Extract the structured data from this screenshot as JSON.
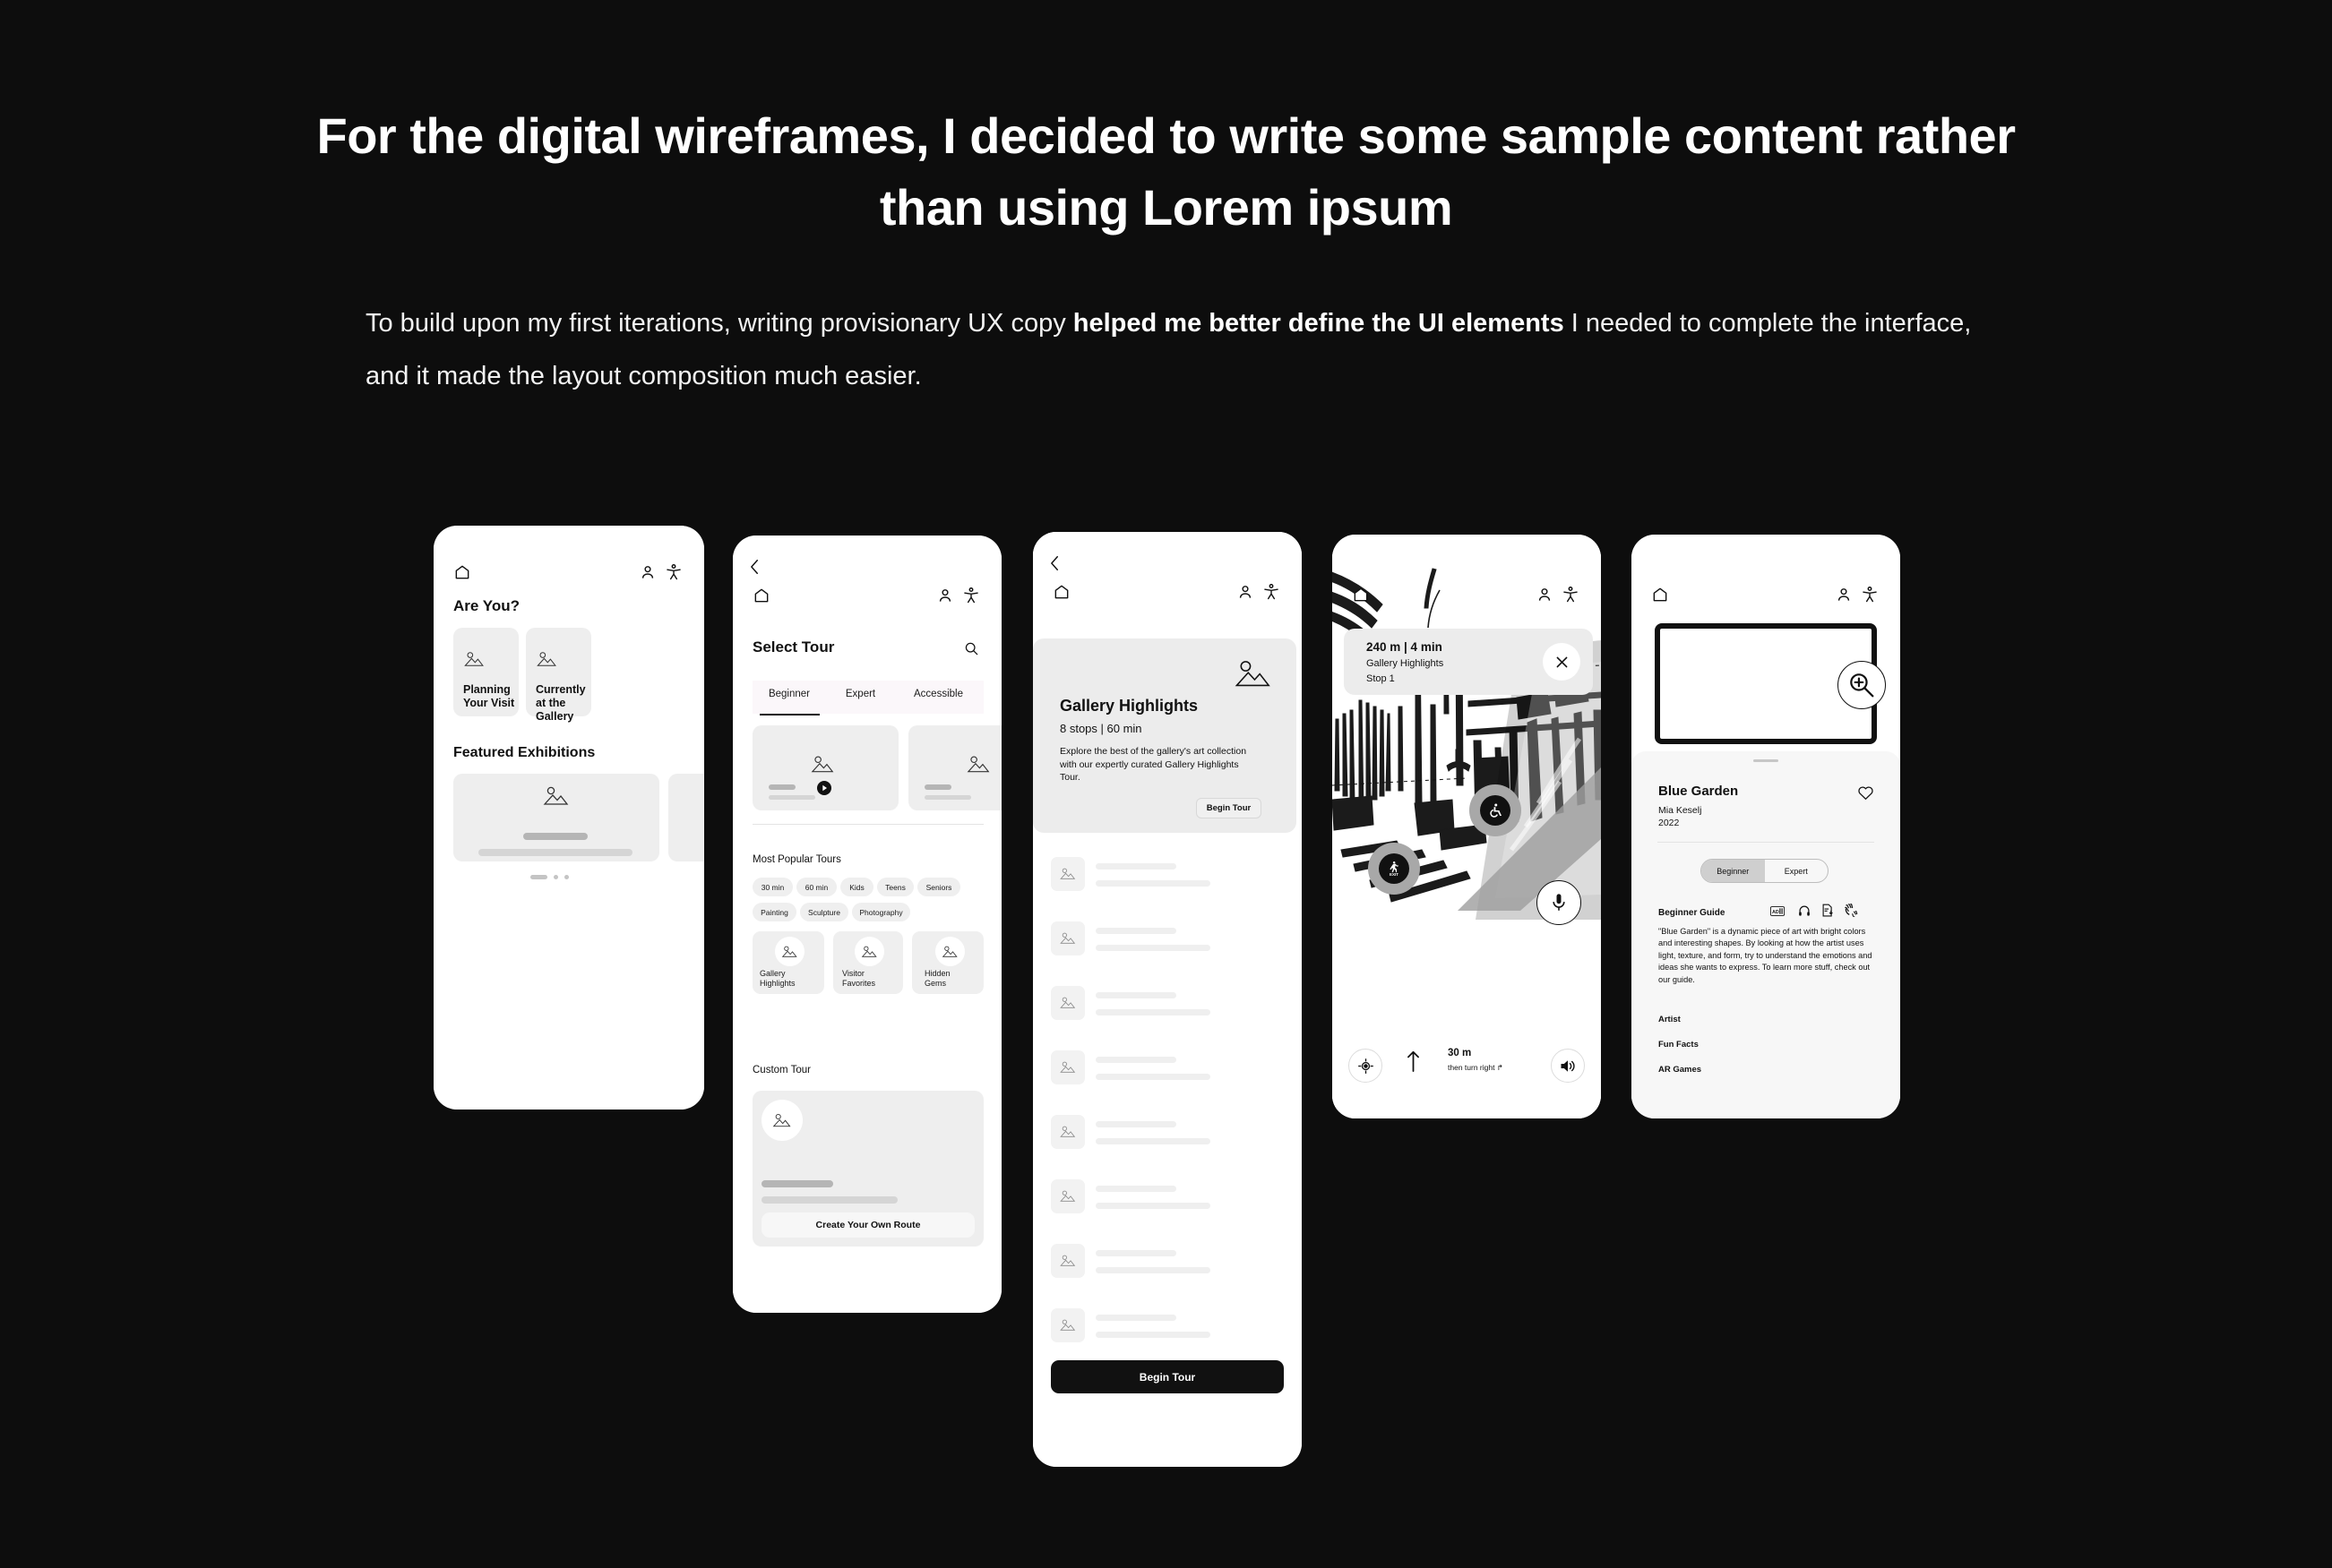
{
  "header": {
    "headline": "For the digital wireframes, I decided to write some  sample content rather than using Lorem ipsum",
    "body_pre": "To build upon my first iterations, writing provisionary UX copy ",
    "body_bold": "helped me better define the UI elements",
    "body_post": " I needed to complete the interface, and it made the layout composition much easier."
  },
  "colors": {
    "background": "#0d0d0d",
    "text": "#ffffff",
    "phone": "#ffffff",
    "placeholder_grey": "#eeeeee",
    "accent_dark": "#111111",
    "tab_strip": "#fbf7fa"
  },
  "screens": [
    {
      "id": "home",
      "icons": {
        "home": "home-icon",
        "profile": "person-icon",
        "accessibility": "accessibility-icon"
      },
      "title": "Are You?",
      "cards": [
        {
          "label": "Planning\nYour Visit",
          "line1": "Planning",
          "line2": "Your Visit",
          "icon": "image-placeholder-icon"
        },
        {
          "label": "Currently\nat the Gallery",
          "line1": "Currently",
          "line2": "at the Gallery",
          "icon": "image-placeholder-icon"
        }
      ],
      "featured_title": "Featured Exhibitions",
      "carousel_dots": 3,
      "carousel_active": 0
    },
    {
      "id": "select-tour",
      "back": "back-chevron-icon",
      "title": "Select Tour",
      "search": "search-icon",
      "tabs": [
        {
          "label": "Beginner",
          "active": true
        },
        {
          "label": "Expert",
          "active": false
        },
        {
          "label": "Accessible",
          "active": false
        }
      ],
      "popular_title": "Most Popular Tours",
      "chips": [
        "30 min",
        "60 min",
        "Kids",
        "Teens",
        "Seniors",
        "Painting",
        "Sculpture",
        "Photography"
      ],
      "tiles": [
        {
          "line1": "Gallery",
          "line2": "Highlights"
        },
        {
          "line1": "Visitor",
          "line2": "Favorites"
        },
        {
          "line1": "Hidden",
          "line2": "Gems"
        }
      ],
      "custom_title": "Custom Tour",
      "custom_button": "Create Your Own Route"
    },
    {
      "id": "tour-detail",
      "back": "back-chevron-icon",
      "title": "Gallery Highlights",
      "subtitle": "8 stops | 60 min",
      "description": "Explore the best of the gallery's art collection with our expertly curated Gallery Highlights Tour.",
      "begin_small": "Begin Tour",
      "begin_primary": "Begin Tour",
      "stop_rows": 8
    },
    {
      "id": "ar-navigation",
      "distance": "240 m | 4 min",
      "tour_name": "Gallery Highlights",
      "stop": "Stop 1",
      "close": "close-icon",
      "pois": [
        {
          "icon": "wheelchair-icon",
          "name": "accessible-route-poi"
        },
        {
          "icon": "exit-icon",
          "label": "EXIT",
          "name": "exit-poi"
        }
      ],
      "mic": "microphone-icon",
      "recenter": "recenter-icon",
      "nav_distance": "30 m",
      "nav_instruction": "then turn right ↱",
      "nav_arrow": "up-arrow-icon",
      "sound": "volume-icon"
    },
    {
      "id": "artwork-detail",
      "zoom": "zoom-in-icon",
      "favorite": "heart-icon",
      "art_title": "Blue Garden",
      "artist": "Mia Keselj",
      "year": "2022",
      "segments": [
        {
          "label": "Beginner",
          "active": true
        },
        {
          "label": "Expert",
          "active": false
        }
      ],
      "guide_heading": "Beginner Guide",
      "guide_icons": [
        "audio-description-icon",
        "headphones-icon",
        "document-download-icon",
        "sign-language-icon"
      ],
      "guide_text": "\"Blue Garden\" is a dynamic piece of art with bright colors and interesting shapes. By looking at how the artist uses light, texture, and form, try to understand the emotions and ideas she wants to express. To learn more stuff, check out our guide.",
      "links": [
        "Artist",
        "Fun Facts",
        "AR Games"
      ]
    }
  ]
}
